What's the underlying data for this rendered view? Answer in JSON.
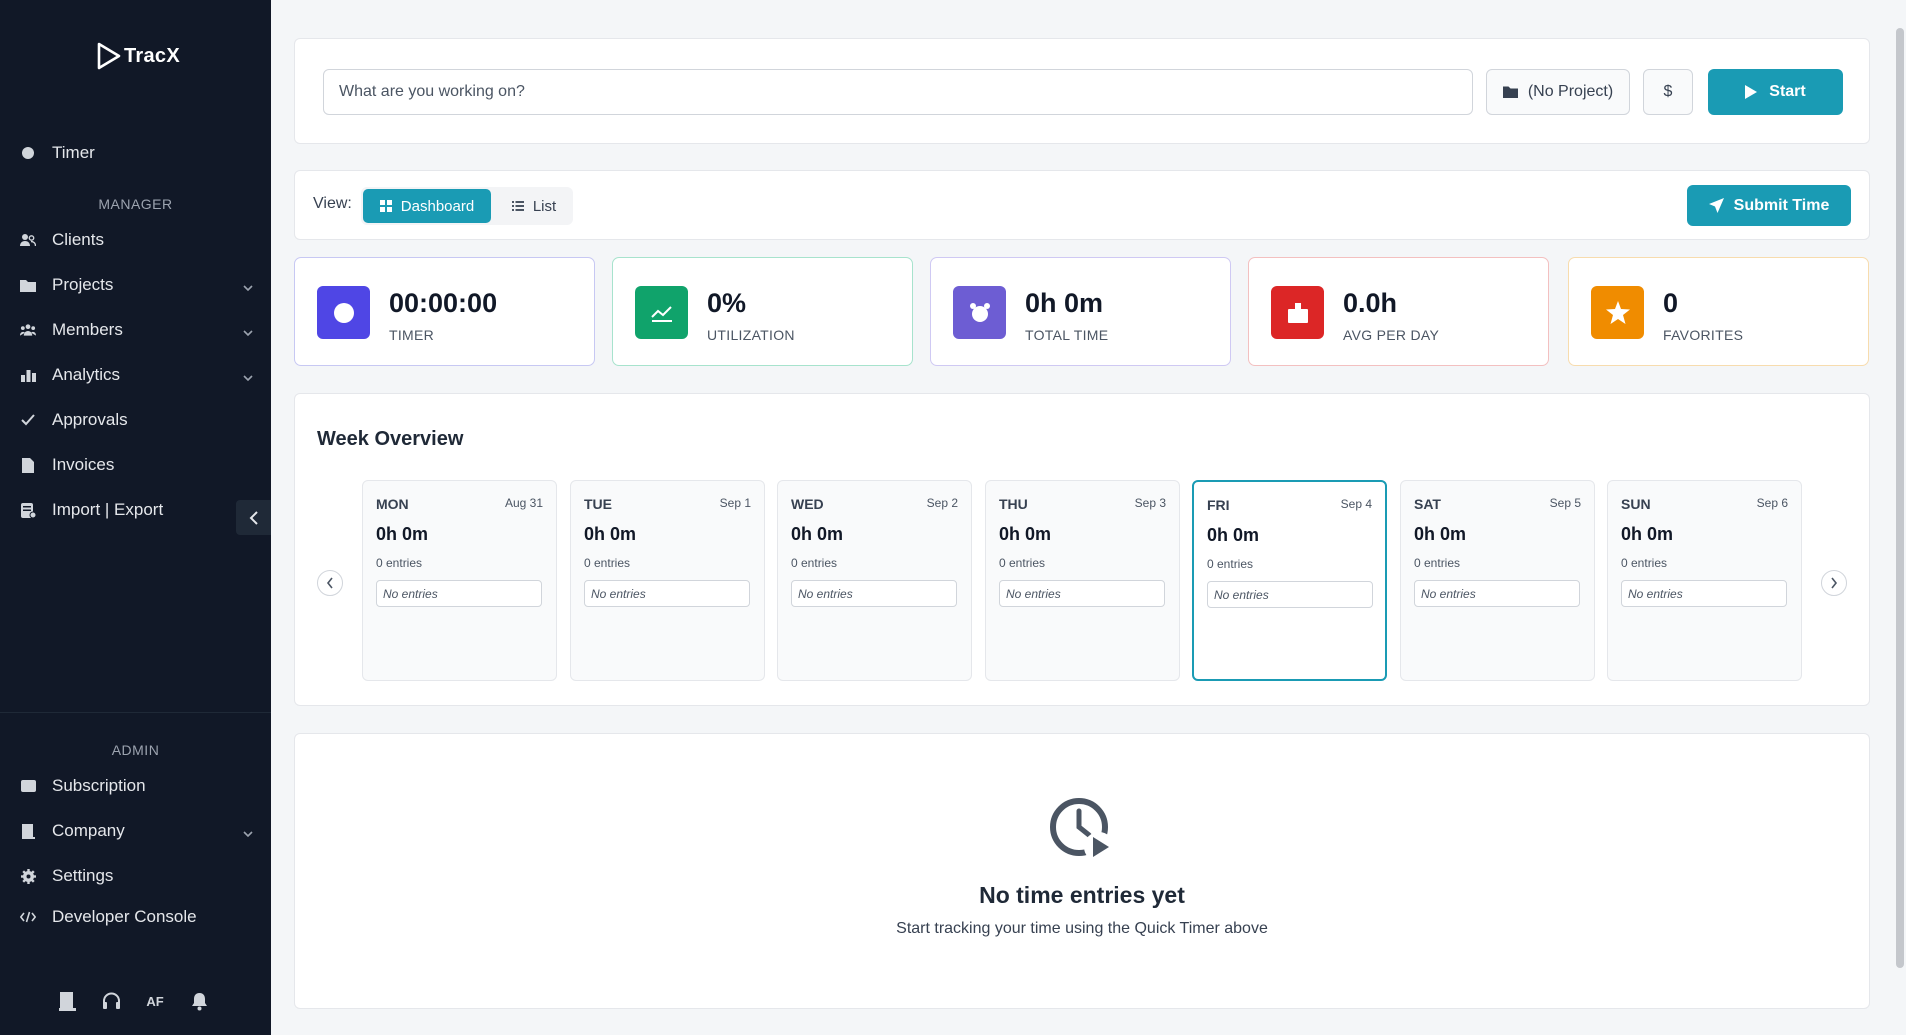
{
  "app": {
    "name": "TracX"
  },
  "sidebar": {
    "timer": "Timer",
    "manager_label": "MANAGER",
    "manager_items": [
      {
        "label": "Clients",
        "icon": "users-icon"
      },
      {
        "label": "Projects",
        "icon": "folder-icon"
      },
      {
        "label": "Members",
        "icon": "people-icon"
      },
      {
        "label": "Analytics",
        "icon": "chart-icon"
      },
      {
        "label": "Approvals",
        "icon": "check-icon"
      },
      {
        "label": "Invoices",
        "icon": "document-icon"
      },
      {
        "label": "Import | Export",
        "icon": "database-icon"
      }
    ],
    "admin_label": "ADMIN",
    "admin_items": [
      {
        "label": "Subscription",
        "icon": "card-icon"
      },
      {
        "label": "Company",
        "icon": "building-icon"
      },
      {
        "label": "Settings",
        "icon": "gear-icon"
      },
      {
        "label": "Developer Console",
        "icon": "code-icon"
      }
    ],
    "user_initials": "AF"
  },
  "quick_timer": {
    "placeholder": "What are you working on?",
    "project_label": "(No Project)",
    "billable_label": "$",
    "start_label": "Start"
  },
  "view": {
    "label": "View:",
    "dashboard_label": "Dashboard",
    "list_label": "List",
    "submit_label": "Submit Time"
  },
  "stats": [
    {
      "value": "00:00:00",
      "label": "TIMER",
      "color": "#4f46e5"
    },
    {
      "value": "0%",
      "label": "UTILIZATION",
      "color": "#10a36b"
    },
    {
      "value": "0h 0m",
      "label": "TOTAL TIME",
      "color": "#6d5dd3"
    },
    {
      "value": "0.0h",
      "label": "AVG PER DAY",
      "color": "#dc2626"
    },
    {
      "value": "0",
      "label": "FAVORITES",
      "color": "#f08c00"
    }
  ],
  "week": {
    "title": "Week Overview",
    "days": [
      {
        "name": "MON",
        "date": "Aug 31",
        "total": "0h 0m",
        "count": "0 entries",
        "empty": "No entries"
      },
      {
        "name": "TUE",
        "date": "Sep 1",
        "total": "0h 0m",
        "count": "0 entries",
        "empty": "No entries"
      },
      {
        "name": "WED",
        "date": "Sep 2",
        "total": "0h 0m",
        "count": "0 entries",
        "empty": "No entries"
      },
      {
        "name": "THU",
        "date": "Sep 3",
        "total": "0h 0m",
        "count": "0 entries",
        "empty": "No entries"
      },
      {
        "name": "FRI",
        "date": "Sep 4",
        "total": "0h 0m",
        "count": "0 entries",
        "empty": "No entries"
      },
      {
        "name": "SAT",
        "date": "Sep 5",
        "total": "0h 0m",
        "count": "0 entries",
        "empty": "No entries"
      },
      {
        "name": "SUN",
        "date": "Sep 6",
        "total": "0h 0m",
        "count": "0 entries",
        "empty": "No entries"
      }
    ]
  },
  "empty_state": {
    "title": "No time entries yet",
    "subtitle": "Start tracking your time using the Quick Timer above"
  },
  "colors": {
    "sidebar_bg": "#111827",
    "accent": "#1a9bb4"
  }
}
